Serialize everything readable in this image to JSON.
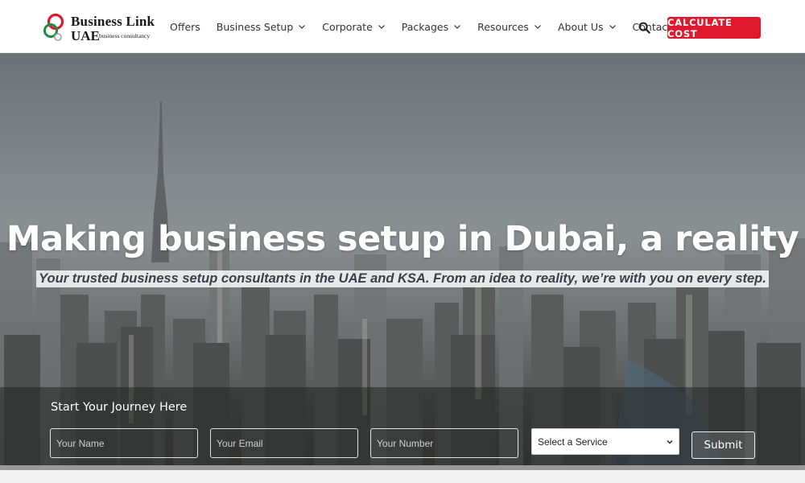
{
  "brand": {
    "title": "Business Link",
    "uae": "UAE",
    "tagline": "business consultancy",
    "colors": {
      "red": "#e0182d",
      "green": "#1d8a3c",
      "gray": "#a8a8a8"
    }
  },
  "nav": {
    "items": [
      {
        "label": "Offers",
        "dropdown": false
      },
      {
        "label": "Business Setup",
        "dropdown": true
      },
      {
        "label": "Corporate",
        "dropdown": true
      },
      {
        "label": "Packages",
        "dropdown": true
      },
      {
        "label": "Resources",
        "dropdown": true
      },
      {
        "label": "About Us",
        "dropdown": true
      },
      {
        "label": "Contact",
        "dropdown": false
      }
    ],
    "search_icon": "search-icon",
    "cta_label": "CALCULATE COST",
    "cta_color": "#e0182d"
  },
  "hero": {
    "title": "Making business setup in Dubai, a reality",
    "subtitle": "Your trusted business setup consultants in the UAE and KSA. From an idea to reality, we’re with you on every step."
  },
  "form": {
    "heading": "Start Your Journey Here",
    "name_placeholder": "Your Name",
    "email_placeholder": "Your Email",
    "number_placeholder": "Your Number",
    "service_selected": "Select a Service",
    "submit_label": "Submit"
  }
}
